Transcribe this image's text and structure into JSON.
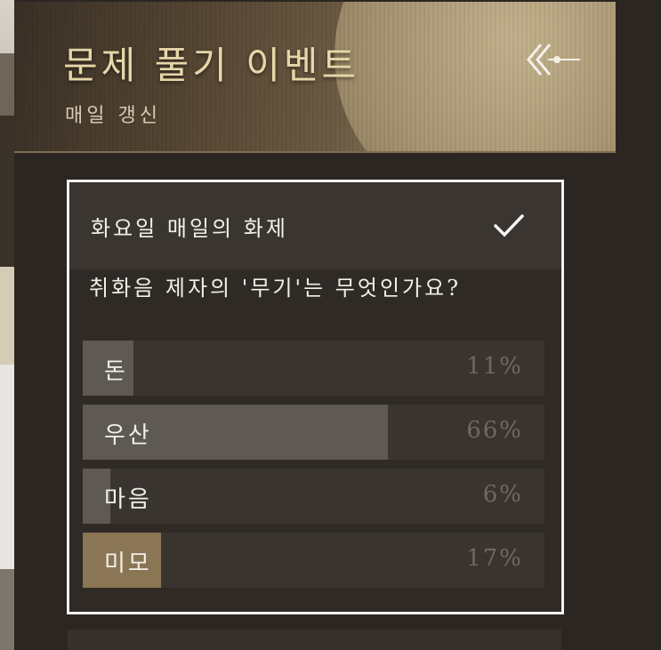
{
  "header": {
    "title": "문제 풀기 이벤트",
    "subtitle": "매일 갱신",
    "back_icon": "back-arrow-icon"
  },
  "quiz": {
    "day_label": "화요일 매일의 화제",
    "status_icon": "check-icon",
    "question": "취화음 제자의 '무기'는 무엇인가요?",
    "options": [
      {
        "label": "돈",
        "percent_text": "11%",
        "percent": 11,
        "selected": false
      },
      {
        "label": "우산",
        "percent_text": "66%",
        "percent": 66,
        "selected": false
      },
      {
        "label": "마음",
        "percent_text": "6%",
        "percent": 6,
        "selected": false
      },
      {
        "label": "미모",
        "percent_text": "17%",
        "percent": 17,
        "selected": true
      }
    ]
  },
  "colors": {
    "title_gold": "#e7d6a8",
    "bar_default": "#5f5955",
    "bar_selected": "#8a7655",
    "card_border": "#f2f2f2"
  }
}
